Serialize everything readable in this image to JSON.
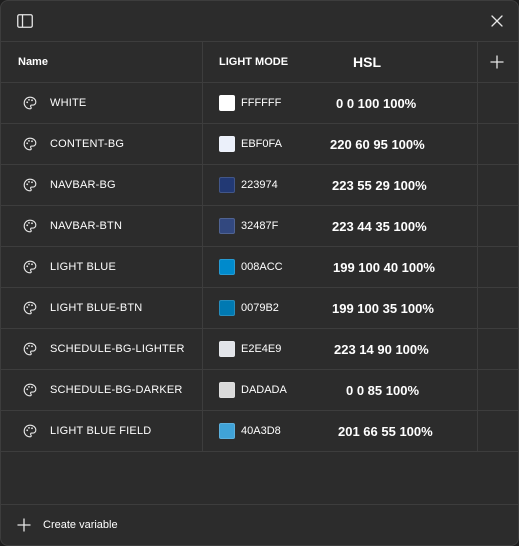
{
  "header": {
    "name_col": "Name",
    "mode_col": "LIGHT MODE",
    "hsl_col": "HSL"
  },
  "rows": [
    {
      "name": "WHITE",
      "hex": "FFFFFF",
      "color": "#FFFFFF",
      "hsl": "0 0 100 100%"
    },
    {
      "name": "CONTENT-BG",
      "hex": "EBF0FA",
      "color": "#EBF0FA",
      "hsl": "220 60 95 100%"
    },
    {
      "name": "NAVBAR-BG",
      "hex": "223974",
      "color": "#223974",
      "hsl": "223 55 29 100%"
    },
    {
      "name": "NAVBAR-BTN",
      "hex": "32487F",
      "color": "#32487F",
      "hsl": "223 44 35 100%"
    },
    {
      "name": "LIGHT BLUE",
      "hex": "008ACC",
      "color": "#008ACC",
      "hsl": "199 100 40 100%"
    },
    {
      "name": "LIGHT BLUE-BTN",
      "hex": "0079B2",
      "color": "#0079B2",
      "hsl": "199 100 35 100%"
    },
    {
      "name": "SCHEDULE-BG-LIGHTER",
      "hex": "E2E4E9",
      "color": "#E2E4E9",
      "hsl": "223 14 90 100%"
    },
    {
      "name": "SCHEDULE-BG-DARKER",
      "hex": "DADADA",
      "color": "#DADADA",
      "hsl": "0 0 85 100%"
    },
    {
      "name": "LIGHT BLUE FIELD",
      "hex": "40A3D8",
      "color": "#40A3D8",
      "hsl": "201 66 55 100%"
    }
  ],
  "footer": {
    "create_label": "Create variable"
  },
  "icons": {
    "sidebar": "sidebar-toggle-icon",
    "close": "close-icon",
    "add_column": "plus-icon",
    "row": "palette-icon",
    "create": "plus-icon"
  }
}
